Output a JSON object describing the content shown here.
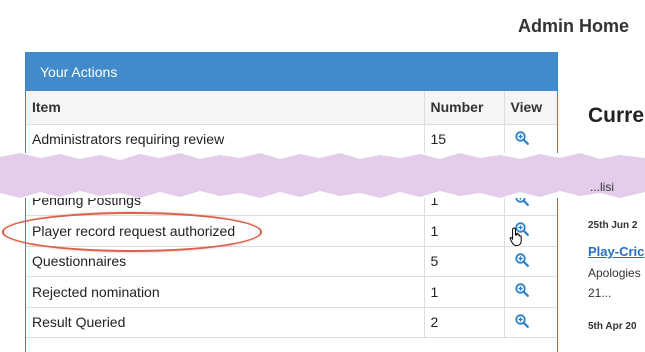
{
  "header": {
    "title": "Admin Home"
  },
  "actions_panel": {
    "heading": "Your Actions",
    "columns": [
      "Item",
      "Number",
      "View"
    ],
    "rows": [
      {
        "item": "Administrators requiring review",
        "number": "15"
      },
      {
        "item": "",
        "number": ""
      },
      {
        "item": "Pending Postings",
        "number": "1"
      },
      {
        "item": "Player record request authorized",
        "number": "1"
      },
      {
        "item": "Questionnaires",
        "number": "5"
      },
      {
        "item": "Rejected nomination",
        "number": "1"
      },
      {
        "item": "Result Queried",
        "number": "2"
      }
    ]
  },
  "right_panel": {
    "title": "Curre",
    "snippet_top": "...lisi",
    "date1": "25th Jun 2",
    "link1": "Play-Cric",
    "text1": "Apologies",
    "text2": "21...",
    "date2": "5th Apr 20"
  },
  "colors": {
    "panel_heading": "#428bca",
    "link": "#2a6ebb",
    "highlight": "#d9604a",
    "redaction": "#e3cdea"
  },
  "icons": {
    "view": "magnifier-plus-icon",
    "cursor": "hand-pointer-icon"
  }
}
